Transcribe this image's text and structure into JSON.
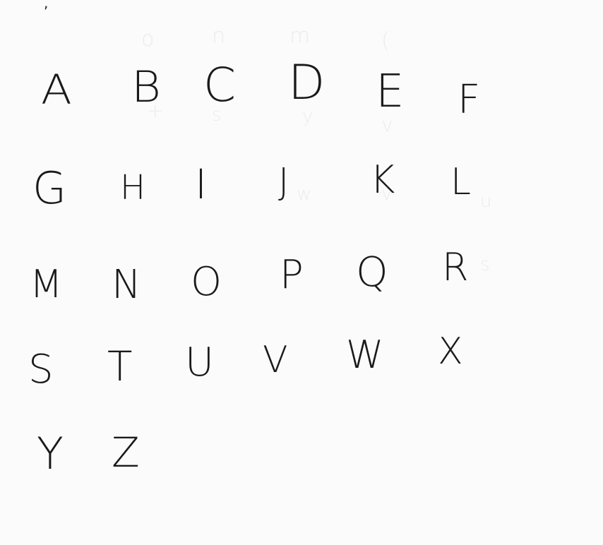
{
  "sheet": {
    "letters": [
      {
        "char": "A"
      },
      {
        "char": "B"
      },
      {
        "char": "C"
      },
      {
        "char": "D"
      },
      {
        "char": "E"
      },
      {
        "char": "F"
      },
      {
        "char": "G"
      },
      {
        "char": "H"
      },
      {
        "char": "I"
      },
      {
        "char": "J"
      },
      {
        "char": "K"
      },
      {
        "char": "L"
      },
      {
        "char": "M"
      },
      {
        "char": "N"
      },
      {
        "char": "O"
      },
      {
        "char": "P"
      },
      {
        "char": "Q"
      },
      {
        "char": "R"
      },
      {
        "char": "S"
      },
      {
        "char": "T"
      },
      {
        "char": "U"
      },
      {
        "char": "V"
      },
      {
        "char": "W"
      },
      {
        "char": "X"
      },
      {
        "char": "Y"
      },
      {
        "char": "Z"
      }
    ]
  }
}
